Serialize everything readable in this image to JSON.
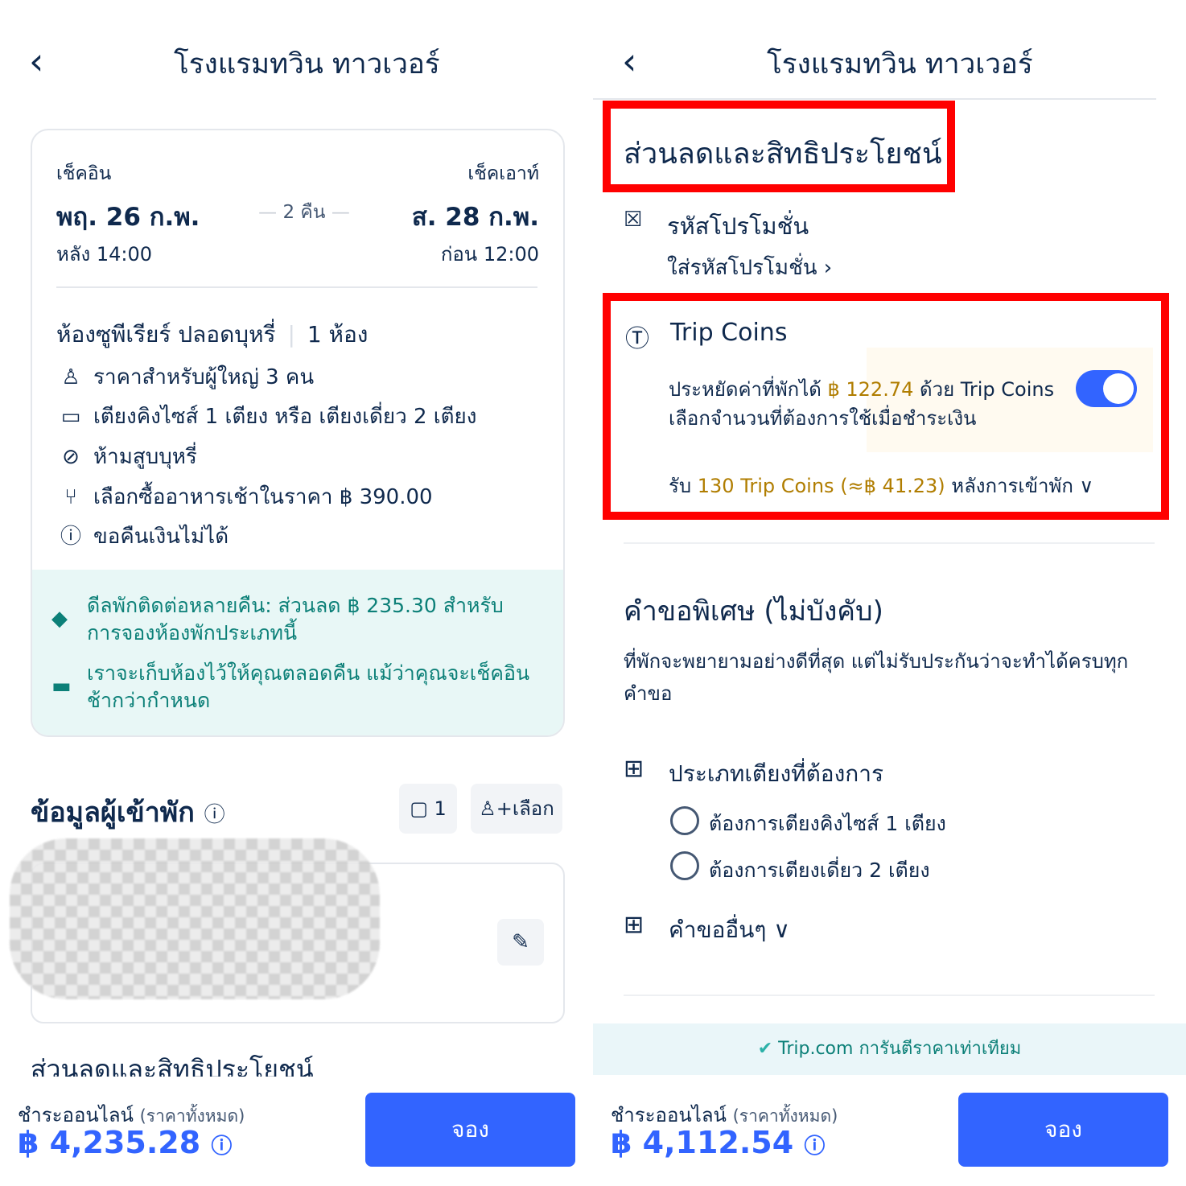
{
  "colors": {
    "primary": "#3264ff",
    "promo_text": "#0c8078",
    "gold": "#b07d00",
    "highlight": "#ff0000"
  },
  "left": {
    "back_icon": "chevron-left-icon",
    "header_title": "โรงแรมทวิน ทาวเวอร์",
    "checkin_label": "เช็คอิน",
    "checkin_date": "พฤ. 26 ก.พ.",
    "checkin_time": "หลัง 14:00",
    "nights": "2 คืน",
    "checkout_label": "เช็คเอาท์",
    "checkout_date": "ส. 28 ก.พ.",
    "checkout_time": "ก่อน 12:00",
    "room_name": "ห้องซูพีเรียร์ ปลอดบุหรี่",
    "room_count": "1 ห้อง",
    "features": [
      {
        "icon": "person-icon",
        "text": "ราคาสำหรับผู้ใหญ่ 3 คน"
      },
      {
        "icon": "bed-icon",
        "text": "เตียงคิงไซส์ 1 เตียง หรือ เตียงเดี่ยว 2 เตียง"
      },
      {
        "icon": "no-smoking-icon",
        "text": "ห้ามสูบบุหรี่"
      },
      {
        "icon": "utensils-icon",
        "text": "เลือกซื้ออาหารเช้าในราคา ฿ 390.00"
      },
      {
        "icon": "alert-circle-icon",
        "text": "ขอคืนเงินไม่ได้"
      }
    ],
    "promo1_line1": "ดีลพักติดต่อหลายคืน: ส่วนลด ฿ 235.30 สำหรับ",
    "promo1_line2": "การจองห้องพักประเภทนี้",
    "promo2_line1": "เราจะเก็บห้องไว้ให้คุณตลอดคืน แม้ว่าคุณจะเช็คอิน",
    "promo2_line2": "ช้ากว่ากำหนด",
    "guest_title": "ข้อมูลผู้เข้าพัก",
    "guest_count": "1",
    "select_label": "เลือก",
    "next_section": "ส่วนลดและสิทธิประโยชน์",
    "pay_label": "ชำระออนไลน์",
    "pay_sub": "(ราคาทั้งหมด)",
    "price": "฿ 4,235.28",
    "book": "จอง"
  },
  "right": {
    "back_icon": "chevron-left-icon",
    "header_title": "โรงแรมทวิน ทาวเวอร์",
    "section_title": "ส่วนลดและสิทธิประโยชน์",
    "promo_code_title": "รหัสโปรโมชั่น",
    "promo_code_link": "ใส่รหัสโปรโมชั่น",
    "coins_title": "Trip Coins",
    "coins_save_prefix": "ประหยัดค่าที่พักได้",
    "coins_save_amount": "฿ 122.74",
    "coins_save_suffix": "ด้วย Trip Coins",
    "coins_choose": "เลือกจำนวนที่ต้องการใช้เมื่อชำระเงิน",
    "coins_toggle_on": true,
    "coins_earn_prefix": "รับ",
    "coins_earn_amount": "130 Trip Coins (≈฿ 41.23)",
    "coins_earn_suffix": "หลังการเข้าพัก",
    "special_title": "คำขอพิเศษ (ไม่บังคับ)",
    "special_desc_line1": "ที่พักจะพยายามอย่างดีที่สุด แต่ไม่รับประกันว่าจะทำได้ครบทุก",
    "special_desc_line2": "คำขอ",
    "bed_type_title": "ประเภทเตียงที่ต้องการ",
    "bed_options": [
      "ต้องการเตียงคิงไซส์ 1 เตียง",
      "ต้องการเตียงเดี่ยว 2 เตียง"
    ],
    "other_requests": "คำขออื่นๆ",
    "guarantee": "Trip.com การันตีราคาเท่าเทียม",
    "pay_label": "ชำระออนไลน์",
    "pay_sub": "(ราคาทั้งหมด)",
    "price": "฿ 4,112.54",
    "book": "จอง"
  }
}
